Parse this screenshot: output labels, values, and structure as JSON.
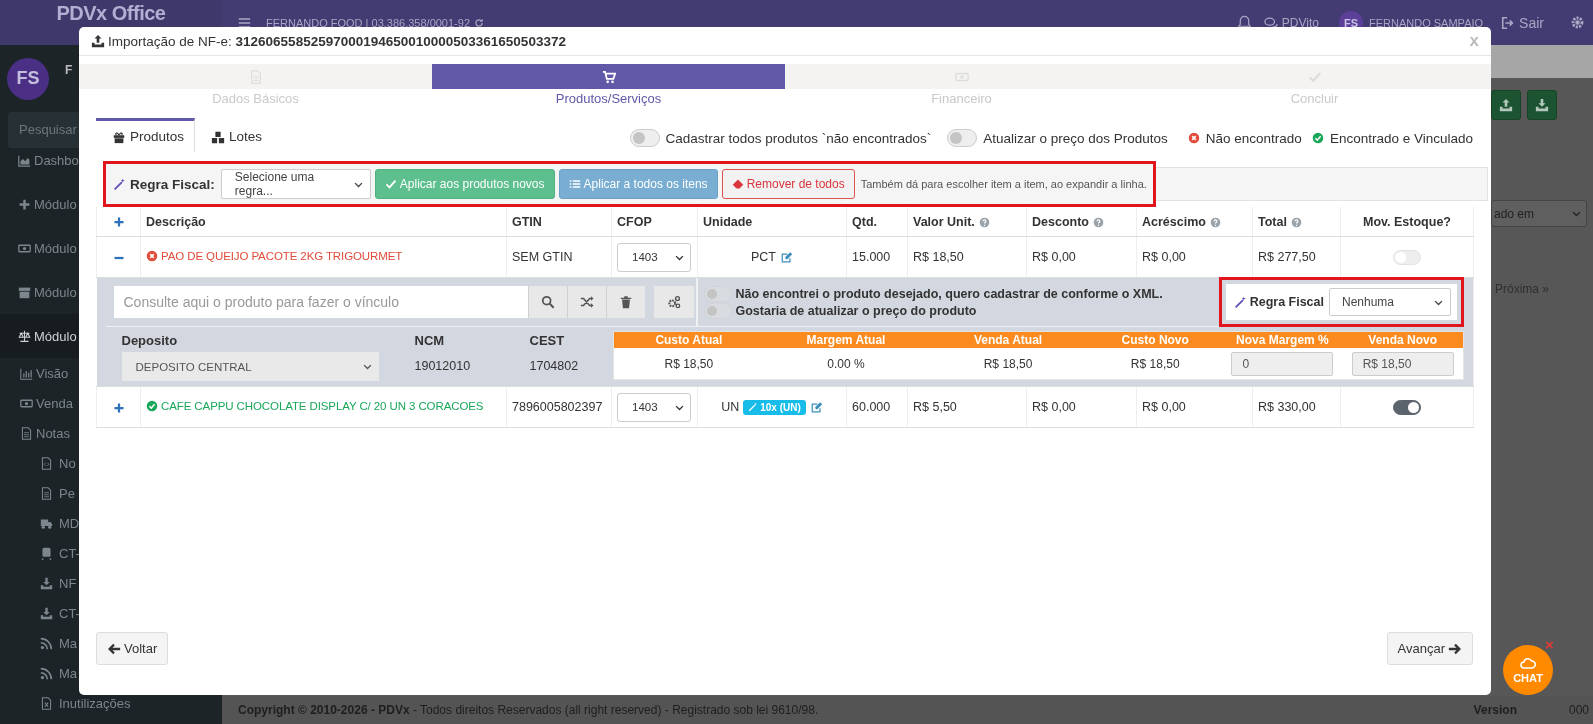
{
  "topbar": {
    "brand": "PDVx Office",
    "company": "FERNANDO FOOD | 03.386.358/0001-92",
    "chat_label": "PDVito",
    "avatar": "FS",
    "user": "FERNANDO SAMPAIO",
    "logout": "Sair"
  },
  "sidebar": {
    "avatar": "FS",
    "user": "F",
    "search_placeholder": "Pesquisar",
    "items": [
      {
        "label": "Dashbo",
        "selected": false
      },
      {
        "label": "Módulo",
        "selected": false
      },
      {
        "label": "Módulo",
        "selected": false
      },
      {
        "label": "Módulo",
        "selected": false
      },
      {
        "label": "Módulo",
        "selected": true,
        "children": [
          {
            "label": "Visão",
            "selected": false
          },
          {
            "label": "Venda",
            "selected": false
          },
          {
            "label": "Notas",
            "selected": false,
            "children": [
              {
                "label": "No",
                "selected": false
              },
              {
                "label": "Pe",
                "selected": false
              },
              {
                "label": "MD",
                "selected": false
              },
              {
                "label": "CT-",
                "selected": false
              },
              {
                "label": "NF",
                "selected": false
              },
              {
                "label": "CT-",
                "selected": false
              },
              {
                "label": "Ma",
                "selected": false
              },
              {
                "label": "Ma",
                "selected": false
              },
              {
                "label": "Inutilizações",
                "selected": false
              }
            ]
          }
        ]
      }
    ]
  },
  "main": {
    "select_value": "ado em",
    "pager_next": "Próxima »"
  },
  "footer": {
    "copyright": "**Copyright © 2010-2026 - PDVx** - Todos direitos Reservados (all right reserved) - Registrado sob lei 9610/98.",
    "version": "Version",
    "version_tail": "000"
  },
  "chat": {
    "label": "CHAT",
    "close": "×"
  },
  "modal": {
    "title": "Importação de NF-e:",
    "key": "31260655852597000194650010000503361650503372",
    "close": "x",
    "steps": [
      {
        "label": "Dados Básicos",
        "selected": false
      },
      {
        "label": "Produtos/Serviços",
        "selected": true
      },
      {
        "label": "Financeiro",
        "selected": false
      },
      {
        "label": "Concluir",
        "selected": false
      }
    ],
    "tabs": [
      {
        "label": "Produtos",
        "selected": true
      },
      {
        "label": "Lotes",
        "selected": false
      }
    ],
    "toggles": [
      {
        "label": "Cadastrar todos produtos `não encontrados`",
        "on": false
      },
      {
        "label": "Atualizar o preço dos Produtos",
        "on": false
      }
    ],
    "legend": [
      {
        "kind": "not_found",
        "label": "Não encontrado"
      },
      {
        "kind": "found",
        "label": "Encontrado e Vinculado"
      }
    ],
    "fiscal_bar": {
      "label": "Regra Fiscal:",
      "select": "Selecione uma regra...",
      "hint": "Também dá para escolher item a item, ao expandir a linha.",
      "buttons": [
        {
          "kind": "success",
          "label": "Aplicar aos produtos novos"
        },
        {
          "kind": "info",
          "label": "Aplicar a todos os itens"
        },
        {
          "kind": "danger",
          "label": "Remover de todos"
        }
      ]
    },
    "table": {
      "columns": [
        {
          "label": "Descrição",
          "help": false
        },
        {
          "label": "GTIN",
          "help": false
        },
        {
          "label": "CFOP",
          "help": false
        },
        {
          "label": "Unidade",
          "help": false
        },
        {
          "label": "Qtd.",
          "help": false
        },
        {
          "label": "Valor Unit.",
          "help": true
        },
        {
          "label": "Desconto",
          "help": true
        },
        {
          "label": "Acréscimo",
          "help": true
        },
        {
          "label": "Total",
          "help": true
        },
        {
          "label": "Mov. Estoque?",
          "help": false
        }
      ],
      "rows": [
        {
          "kind": "not_found",
          "expanded": true,
          "description": "PAO DE QUEIJO PACOTE 2KG TRIGOURMET",
          "gtin": "SEM GTIN",
          "cfop": "1403",
          "unit": "PCT",
          "qty": "15.000",
          "unit_value": "R$ 18,50",
          "discount": "R$ 0,00",
          "addition": "R$ 0,00",
          "total": "R$ 277,50",
          "stock": false,
          "details": {
            "search_placeholder": "Consulte aqui o produto para fazer o vínculo",
            "options": [
              {
                "label": "Não encontrei o produto desejado, quero cadastrar de conforme o XML.",
                "on": false
              },
              {
                "label": "Gostaria de atualizar o preço do produto",
                "on": false
              }
            ],
            "fiscal_label": "Regra Fiscal",
            "fiscal_value": "Nenhuma",
            "deposit_label": "Deposito",
            "deposit_value": "DEPOSITO CENTRAL",
            "ncm_label": "NCM",
            "ncm": "19012010",
            "cest_label": "CEST",
            "cest": "1704802",
            "pricing": {
              "columns": [
                "Custo Atual",
                "Margem Atual",
                "Venda Atual",
                "Custo Novo",
                "Nova Margem %",
                "Venda Novo"
              ],
              "values": [
                {
                  "kind": "text",
                  "value": "R$ 18,50"
                },
                {
                  "kind": "text",
                  "value": "0.00 %"
                },
                {
                  "kind": "text",
                  "value": "R$ 18,50"
                },
                {
                  "kind": "text",
                  "value": "R$ 18,50"
                },
                {
                  "kind": "input",
                  "value": "0"
                },
                {
                  "kind": "input",
                  "value": "R$ 18,50"
                }
              ]
            }
          }
        },
        {
          "kind": "found",
          "expanded": false,
          "description": "CAFE CAPPU CHOCOLATE DISPLAY C/ 20 UN 3 CORACOES",
          "gtin": "7896005802397",
          "cfop": "1403",
          "unit": "UN",
          "badge": "10x (UN)",
          "qty": "60.000",
          "unit_value": "R$ 5,50",
          "discount": "R$ 0,00",
          "addition": "R$ 0,00",
          "total": "R$ 330,00",
          "stock": true
        }
      ]
    },
    "buttons": {
      "back": "Voltar",
      "next": "Avançar"
    }
  }
}
